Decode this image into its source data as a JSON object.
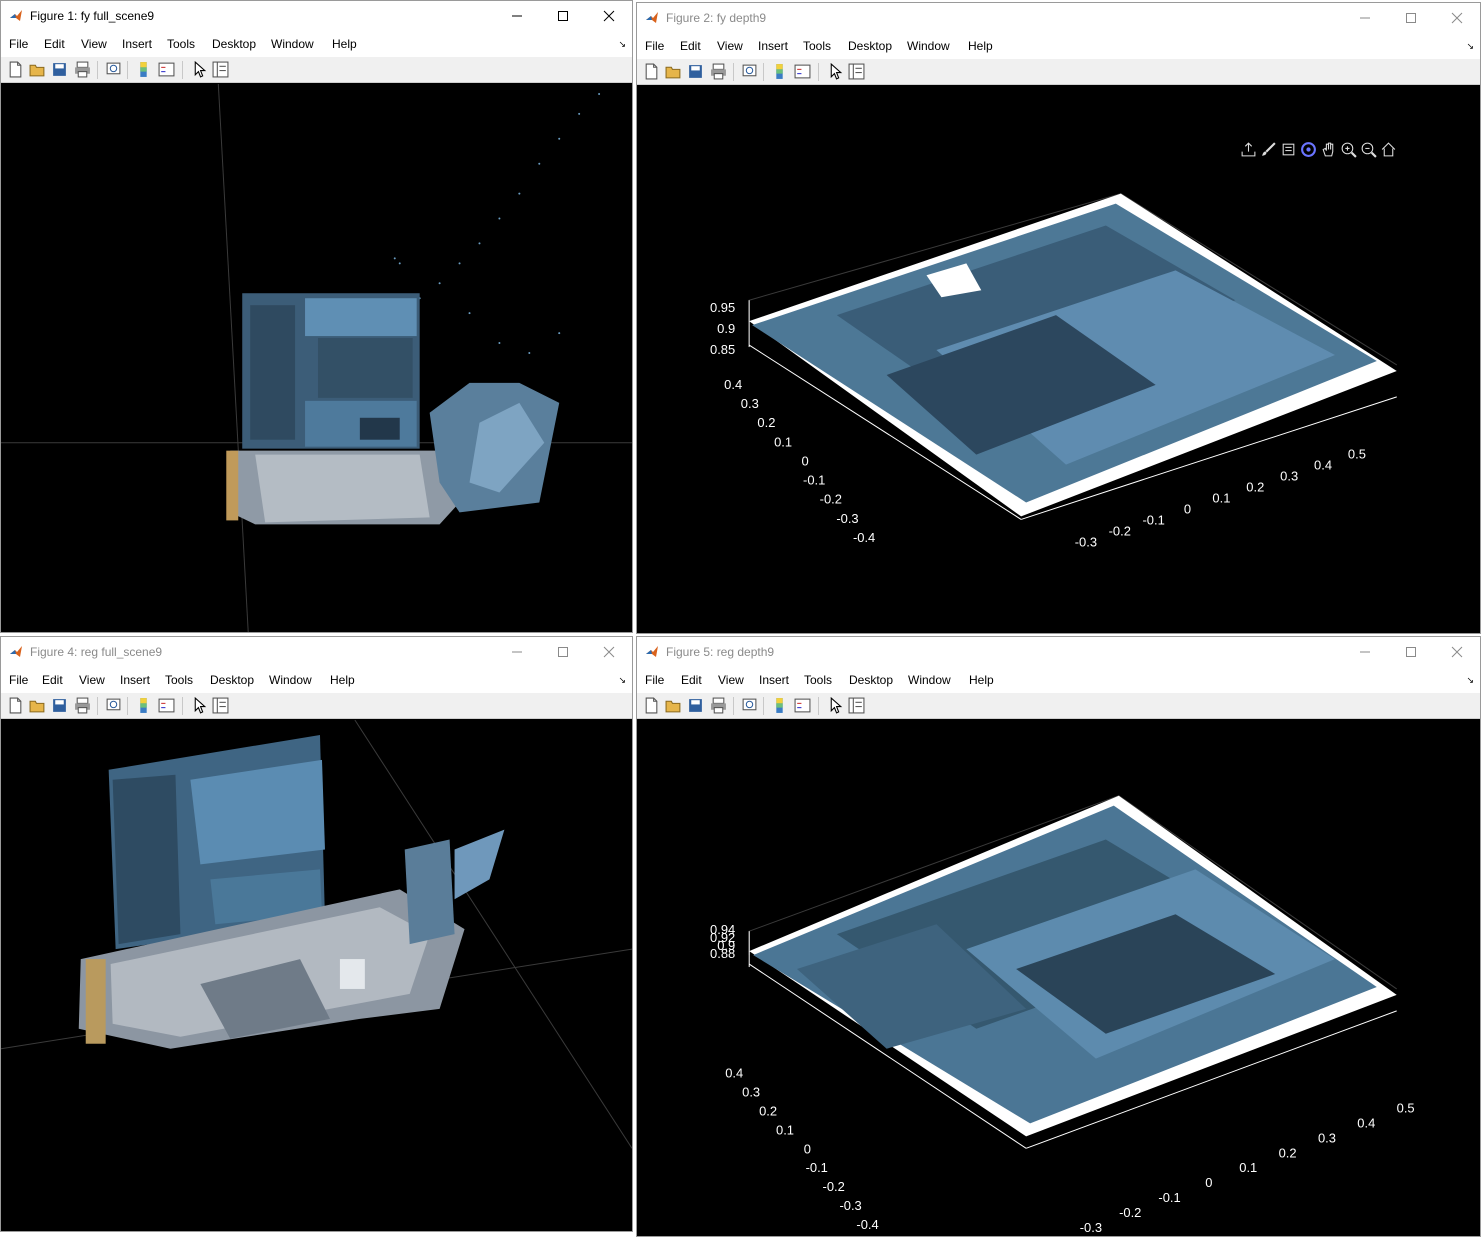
{
  "menu": [
    "File",
    "Edit",
    "View",
    "Insert",
    "Tools",
    "Desktop",
    "Window",
    "Help"
  ],
  "colors": {
    "accent_blue": "#4f7fa6",
    "surface_blue": "#6e9ec4",
    "titlebar": "#ffffff",
    "toolbar": "#f0f0f0"
  },
  "toolbar_icons": [
    "new-file-icon",
    "open-folder-icon",
    "save-icon",
    "print-icon",
    "print-preview-icon",
    "colorbar-icon",
    "legend-icon",
    "pointer-icon",
    "property-editor-icon"
  ],
  "axes_toolbar_icons": [
    "export-icon",
    "brush-icon",
    "data-tip-icon",
    "rotate-3d-icon",
    "pan-icon",
    "zoom-in-icon",
    "zoom-out-icon",
    "home-icon"
  ],
  "fig1": {
    "title": "Figure 1: fy full_scene9"
  },
  "fig2": {
    "title": "Figure 2: fy depth9",
    "z_ticks": [
      "0.95",
      "0.9",
      "0.85"
    ],
    "y_ticks": [
      "0.4",
      "0.3",
      "0.2",
      "0.1",
      "0",
      "-0.1",
      "-0.2",
      "-0.3",
      "-0.4"
    ],
    "x_ticks": [
      "-0.3",
      "-0.2",
      "-0.1",
      "0",
      "0.1",
      "0.2",
      "0.3",
      "0.4",
      "0.5"
    ]
  },
  "fig4": {
    "title": "Figure 4: reg full_scene9"
  },
  "fig5": {
    "title": "Figure 5: reg depth9",
    "z_ticks": [
      "0.94",
      "0.92",
      "0.9",
      "0.88"
    ],
    "y_ticks": [
      "0.4",
      "0.3",
      "0.2",
      "0.1",
      "0",
      "-0.1",
      "-0.2",
      "-0.3",
      "-0.4"
    ],
    "x_ticks": [
      "-0.3",
      "-0.2",
      "-0.1",
      "0",
      "0.1",
      "0.2",
      "0.3",
      "0.4",
      "0.5"
    ]
  }
}
